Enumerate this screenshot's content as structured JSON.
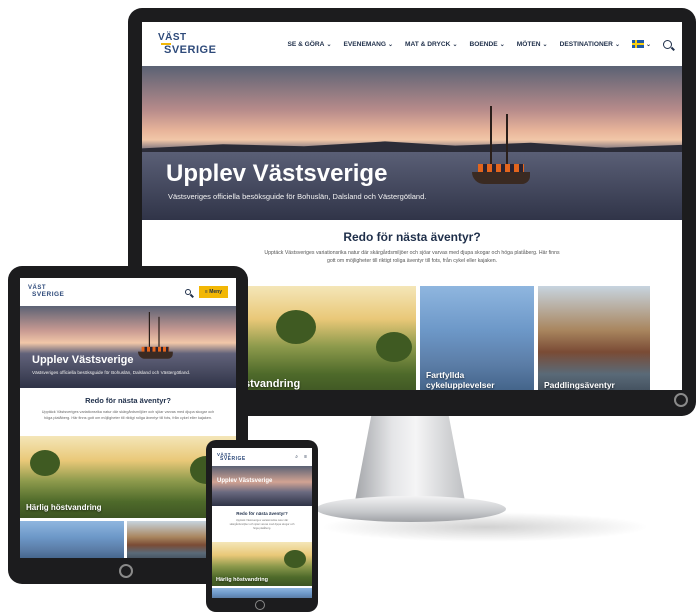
{
  "brand": {
    "logo_line1": "VÄST",
    "logo_line2": "SVERIGE"
  },
  "desktop": {
    "nav": [
      {
        "label": "SE & GÖRA"
      },
      {
        "label": "EVENEMANG"
      },
      {
        "label": "MAT & DRYCK"
      },
      {
        "label": "BOENDE"
      },
      {
        "label": "MÖTEN"
      },
      {
        "label": "DESTINATIONER"
      }
    ],
    "hero_title": "Upplev Västsverige",
    "hero_subtitle": "Västsveriges officiella besöksguide för Bohuslän, Dalsland och Västergötland.",
    "intro_title": "Redo för nästa äventyr?",
    "intro_text": "Upptäck Västsveriges variationsrika natur där skärgårdsmiljöer och sjöar varvas med djupa skogar och höga platåberg. Här finns gott om möjligheter till riktigt roliga äventyr till fots, från cykel eller kajaken.",
    "cards": [
      {
        "label": "stvandring"
      },
      {
        "label": "Fartfyllda cykelupplevelser"
      },
      {
        "label": "Paddlingsäventyr"
      }
    ]
  },
  "tablet": {
    "menu_label": "Meny",
    "hero_title": "Upplev Västsverige",
    "hero_subtitle": "Västsveriges officiella besöksguide för Bohuslän, Dalsland och Västergötland.",
    "intro_title": "Redo för nästa äventyr?",
    "intro_text": "Upptäck Västsveriges variationsrika natur där skärgårdsmiljöer och sjöar varvas med djupa skogar och höga platåberg. Här finns gott om möjligheter till riktigt roliga äventyr till fots, från cykel eller kajaken.",
    "card_label": "Härlig höstvandring"
  },
  "phone": {
    "hero_title": "Upplev Västsverige",
    "intro_title": "Redo för nästa äventyr?",
    "intro_text": "Upptäck Västsveriges variationsrika natur där skärgårdsmiljöer och sjöar varvas med djupa skogar och höga platåberg.",
    "card_label": "Härlig höstvandring"
  },
  "colors": {
    "accent": "#f2b705",
    "navy": "#1f2f4a",
    "device": "#1c1c1e"
  },
  "icons": [
    "chevron-down-icon",
    "sweden-flag-icon",
    "search-icon",
    "menu-icon",
    "power-icon"
  ]
}
